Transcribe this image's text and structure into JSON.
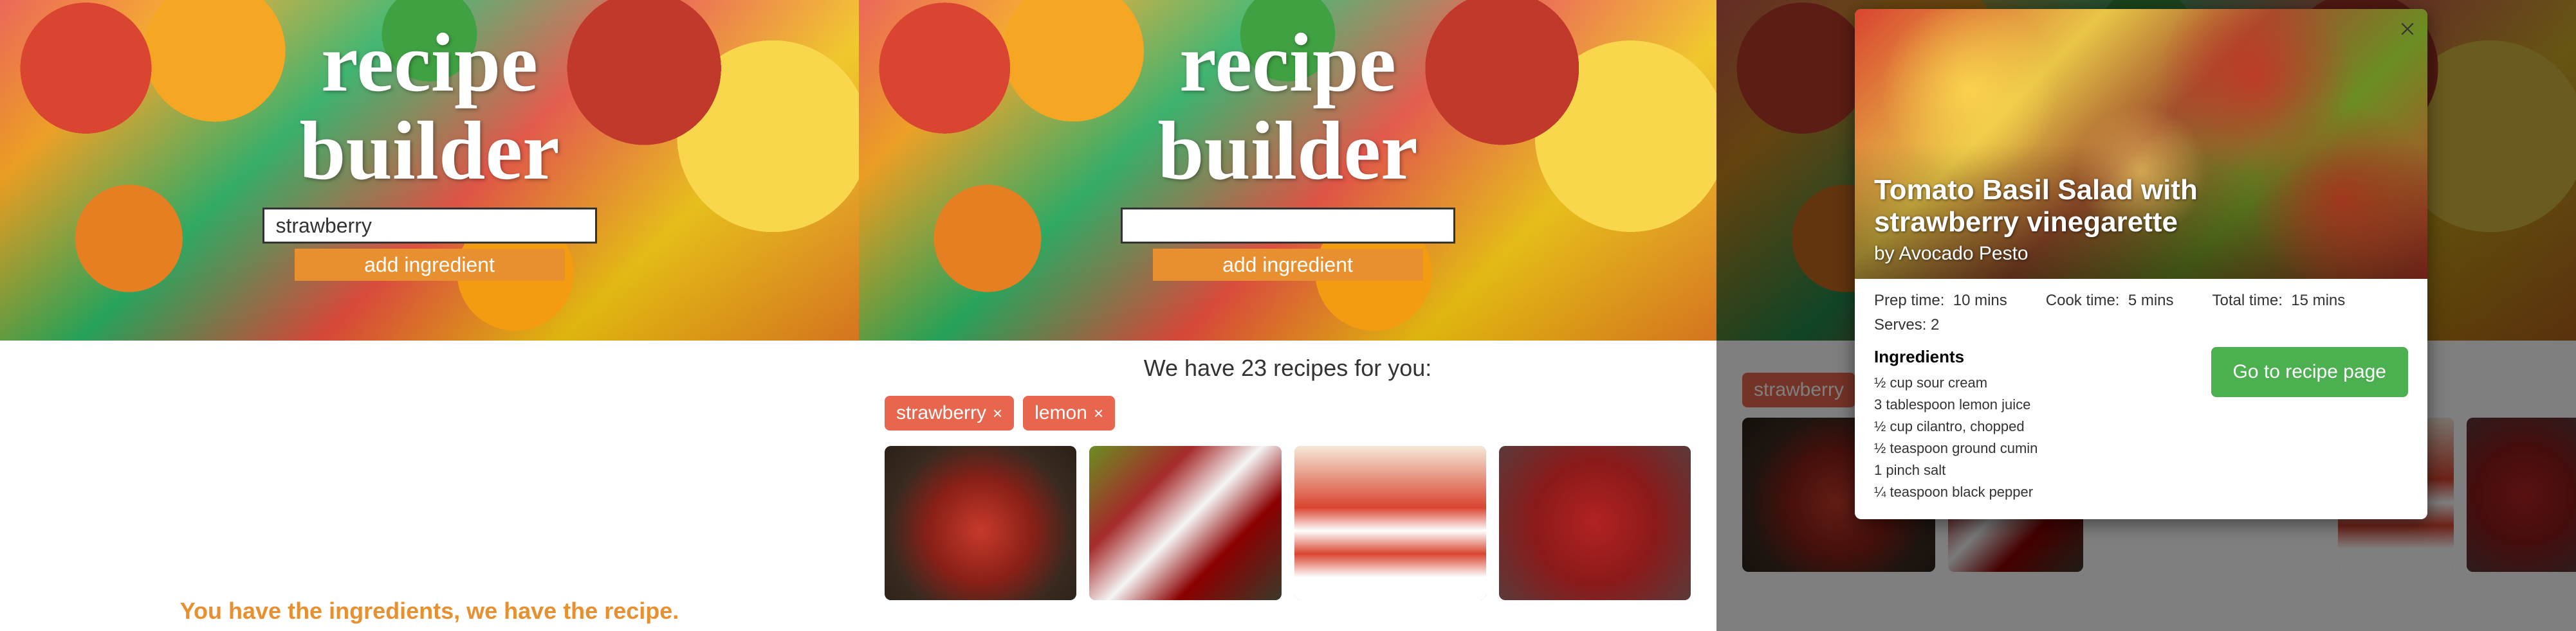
{
  "app_title_line1": "recipe",
  "app_title_line2": "builder",
  "panel1": {
    "input_value": "strawberry",
    "add_button": "add ingredient",
    "tagline": "You have the ingredients, we have the recipe."
  },
  "panel2": {
    "input_value": "",
    "add_button": "add ingredient",
    "results_text": "We have 23 recipes for you:",
    "tags": [
      {
        "label": "strawberry"
      },
      {
        "label": "lemon"
      }
    ]
  },
  "panel3": {
    "bg_tag": "strawberry",
    "modal": {
      "title_line1": "Tomato Basil Salad with",
      "title_line2": "strawberry vinegarette",
      "author": "by Avocado Pesto",
      "prep_label": "Prep time:",
      "prep_value": "10 mins",
      "cook_label": "Cook time:",
      "cook_value": "5 mins",
      "total_label": "Total time:",
      "total_value": "15 mins",
      "serves_label": "Serves:",
      "serves_value": "2",
      "ingredients_heading": "Ingredients",
      "ingredients": [
        "½ cup sour cream",
        "3 tablespoon lemon juice",
        "½ cup cilantro, chopped",
        "½ teaspoon ground cumin",
        "1 pinch salt",
        "¼ teaspoon black pepper"
      ],
      "go_button": "Go to recipe page"
    }
  }
}
